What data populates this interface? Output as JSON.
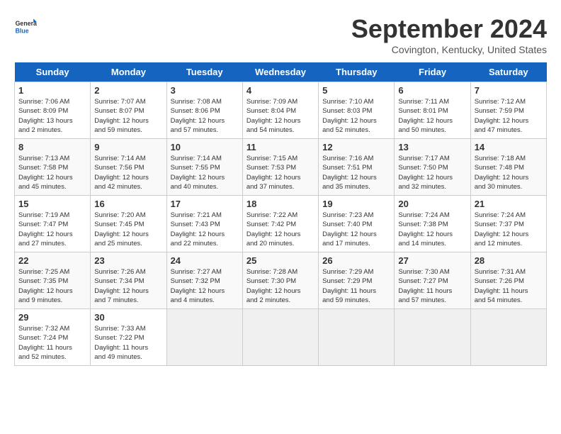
{
  "header": {
    "logo_line1": "General",
    "logo_line2": "Blue",
    "title": "September 2024",
    "location": "Covington, Kentucky, United States"
  },
  "weekdays": [
    "Sunday",
    "Monday",
    "Tuesday",
    "Wednesday",
    "Thursday",
    "Friday",
    "Saturday"
  ],
  "weeks": [
    [
      {
        "day": "1",
        "info": "Sunrise: 7:06 AM\nSunset: 8:09 PM\nDaylight: 13 hours\nand 2 minutes."
      },
      {
        "day": "2",
        "info": "Sunrise: 7:07 AM\nSunset: 8:07 PM\nDaylight: 12 hours\nand 59 minutes."
      },
      {
        "day": "3",
        "info": "Sunrise: 7:08 AM\nSunset: 8:06 PM\nDaylight: 12 hours\nand 57 minutes."
      },
      {
        "day": "4",
        "info": "Sunrise: 7:09 AM\nSunset: 8:04 PM\nDaylight: 12 hours\nand 54 minutes."
      },
      {
        "day": "5",
        "info": "Sunrise: 7:10 AM\nSunset: 8:03 PM\nDaylight: 12 hours\nand 52 minutes."
      },
      {
        "day": "6",
        "info": "Sunrise: 7:11 AM\nSunset: 8:01 PM\nDaylight: 12 hours\nand 50 minutes."
      },
      {
        "day": "7",
        "info": "Sunrise: 7:12 AM\nSunset: 7:59 PM\nDaylight: 12 hours\nand 47 minutes."
      }
    ],
    [
      {
        "day": "8",
        "info": "Sunrise: 7:13 AM\nSunset: 7:58 PM\nDaylight: 12 hours\nand 45 minutes."
      },
      {
        "day": "9",
        "info": "Sunrise: 7:14 AM\nSunset: 7:56 PM\nDaylight: 12 hours\nand 42 minutes."
      },
      {
        "day": "10",
        "info": "Sunrise: 7:14 AM\nSunset: 7:55 PM\nDaylight: 12 hours\nand 40 minutes."
      },
      {
        "day": "11",
        "info": "Sunrise: 7:15 AM\nSunset: 7:53 PM\nDaylight: 12 hours\nand 37 minutes."
      },
      {
        "day": "12",
        "info": "Sunrise: 7:16 AM\nSunset: 7:51 PM\nDaylight: 12 hours\nand 35 minutes."
      },
      {
        "day": "13",
        "info": "Sunrise: 7:17 AM\nSunset: 7:50 PM\nDaylight: 12 hours\nand 32 minutes."
      },
      {
        "day": "14",
        "info": "Sunrise: 7:18 AM\nSunset: 7:48 PM\nDaylight: 12 hours\nand 30 minutes."
      }
    ],
    [
      {
        "day": "15",
        "info": "Sunrise: 7:19 AM\nSunset: 7:47 PM\nDaylight: 12 hours\nand 27 minutes."
      },
      {
        "day": "16",
        "info": "Sunrise: 7:20 AM\nSunset: 7:45 PM\nDaylight: 12 hours\nand 25 minutes."
      },
      {
        "day": "17",
        "info": "Sunrise: 7:21 AM\nSunset: 7:43 PM\nDaylight: 12 hours\nand 22 minutes."
      },
      {
        "day": "18",
        "info": "Sunrise: 7:22 AM\nSunset: 7:42 PM\nDaylight: 12 hours\nand 20 minutes."
      },
      {
        "day": "19",
        "info": "Sunrise: 7:23 AM\nSunset: 7:40 PM\nDaylight: 12 hours\nand 17 minutes."
      },
      {
        "day": "20",
        "info": "Sunrise: 7:24 AM\nSunset: 7:38 PM\nDaylight: 12 hours\nand 14 minutes."
      },
      {
        "day": "21",
        "info": "Sunrise: 7:24 AM\nSunset: 7:37 PM\nDaylight: 12 hours\nand 12 minutes."
      }
    ],
    [
      {
        "day": "22",
        "info": "Sunrise: 7:25 AM\nSunset: 7:35 PM\nDaylight: 12 hours\nand 9 minutes."
      },
      {
        "day": "23",
        "info": "Sunrise: 7:26 AM\nSunset: 7:34 PM\nDaylight: 12 hours\nand 7 minutes."
      },
      {
        "day": "24",
        "info": "Sunrise: 7:27 AM\nSunset: 7:32 PM\nDaylight: 12 hours\nand 4 minutes."
      },
      {
        "day": "25",
        "info": "Sunrise: 7:28 AM\nSunset: 7:30 PM\nDaylight: 12 hours\nand 2 minutes."
      },
      {
        "day": "26",
        "info": "Sunrise: 7:29 AM\nSunset: 7:29 PM\nDaylight: 11 hours\nand 59 minutes."
      },
      {
        "day": "27",
        "info": "Sunrise: 7:30 AM\nSunset: 7:27 PM\nDaylight: 11 hours\nand 57 minutes."
      },
      {
        "day": "28",
        "info": "Sunrise: 7:31 AM\nSunset: 7:26 PM\nDaylight: 11 hours\nand 54 minutes."
      }
    ],
    [
      {
        "day": "29",
        "info": "Sunrise: 7:32 AM\nSunset: 7:24 PM\nDaylight: 11 hours\nand 52 minutes."
      },
      {
        "day": "30",
        "info": "Sunrise: 7:33 AM\nSunset: 7:22 PM\nDaylight: 11 hours\nand 49 minutes."
      },
      {
        "day": "",
        "info": ""
      },
      {
        "day": "",
        "info": ""
      },
      {
        "day": "",
        "info": ""
      },
      {
        "day": "",
        "info": ""
      },
      {
        "day": "",
        "info": ""
      }
    ]
  ]
}
